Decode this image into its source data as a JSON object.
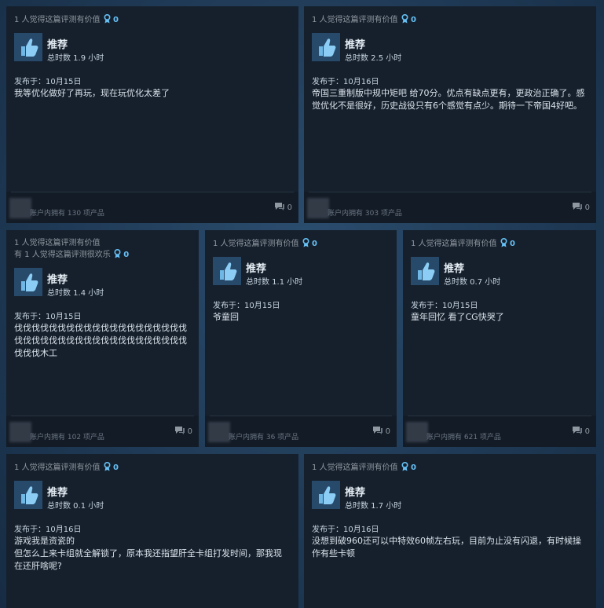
{
  "accent": "#66c0f4",
  "reviews": [
    {
      "helpful": [
        "1 人觉得这篇评测有价值"
      ],
      "award_count": "0",
      "recommendation": "推荐",
      "hours": "总时数 1.9 小时",
      "posted": "发布于：10月15日",
      "text": "我等优化做好了再玩，现在玩优化太差了",
      "products_owned": "账户内拥有 130 项产品",
      "comment_count": "0"
    },
    {
      "helpful": [
        "1 人觉得这篇评测有价值"
      ],
      "award_count": "0",
      "recommendation": "推荐",
      "hours": "总时数 2.5 小时",
      "posted": "发布于：10月16日",
      "text": "帝国三重制版中规中矩吧 给70分。优点有缺点更有，更政治正确了。感觉优化不是很好，历史战役只有6个感觉有点少。期待一下帝国4好吧。",
      "products_owned": "账户内拥有 303 项产品",
      "comment_count": "0"
    },
    {
      "helpful": [
        "1 人觉得这篇评测有价值",
        "有 1 人觉得这篇评测很欢乐"
      ],
      "award_count": "0",
      "recommendation": "推荐",
      "hours": "总时数 1.4 小时",
      "posted": "发布于：10月15日",
      "text": "伐伐伐伐伐伐伐伐伐伐伐伐伐伐伐伐伐伐伐伐伐伐伐伐伐伐伐伐伐伐伐伐伐伐伐伐伐伐伐伐伐伐伐木工",
      "products_owned": "账户内拥有 102 项产品",
      "comment_count": "0"
    },
    {
      "helpful": [
        "1 人觉得这篇评测有价值"
      ],
      "award_count": "0",
      "recommendation": "推荐",
      "hours": "总时数 1.1 小时",
      "posted": "发布于：10月15日",
      "text": "爷童回",
      "products_owned": "账户内拥有 36 项产品",
      "comment_count": "0"
    },
    {
      "helpful": [
        "1 人觉得这篇评测有价值"
      ],
      "award_count": "0",
      "recommendation": "推荐",
      "hours": "总时数 0.7 小时",
      "posted": "发布于：10月15日",
      "text": "童年回忆 看了CG快哭了",
      "products_owned": "账户内拥有 621 项产品",
      "comment_count": "0"
    },
    {
      "helpful": [
        "1 人觉得这篇评测有价值"
      ],
      "award_count": "0",
      "recommendation": "推荐",
      "hours": "总时数 0.1 小时",
      "posted": "发布于：10月16日",
      "text": "游戏我是资瓷的\n但怎么上来卡组就全解锁了，原本我还指望肝全卡组打发时间，那我现在还肝啥呢?",
      "products_owned": "",
      "comment_count": ""
    },
    {
      "helpful": [
        "1 人觉得这篇评测有价值"
      ],
      "award_count": "0",
      "recommendation": "推荐",
      "hours": "总时数 1.7 小时",
      "posted": "发布于：10月16日",
      "text": "没想到破960还可以中特效60帧左右玩，目前为止没有闪退，有时候操作有些卡顿",
      "products_owned": "",
      "comment_count": ""
    }
  ]
}
